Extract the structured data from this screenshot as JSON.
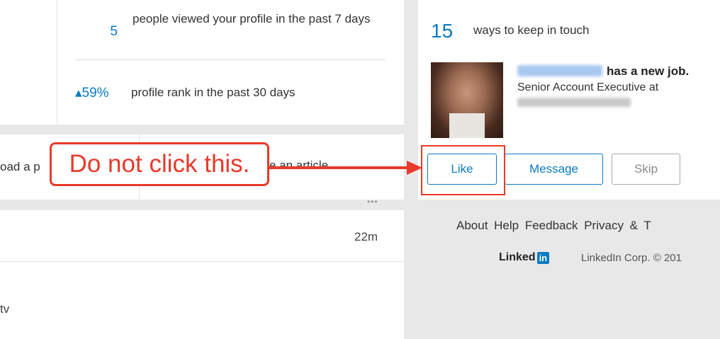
{
  "stats": {
    "views_count": "5",
    "views_text": "people viewed your profile in the past 7 days",
    "rank_change": "▴59%",
    "rank_text": "profile rank in the past 30 days"
  },
  "share": {
    "left_text": "oad a p",
    "right_text": "e an article"
  },
  "feed": {
    "time": "22m",
    "snippet": "tv",
    "more": "•••"
  },
  "keep_in_touch": {
    "count": "15",
    "label": "ways to keep in touch",
    "headline_suffix": "has a new job.",
    "job_title": "Senior Account Executive at"
  },
  "actions": {
    "like": "Like",
    "message": "Message",
    "skip": "Skip"
  },
  "footer": {
    "links": "About Help Feedback Privacy & T",
    "logo_word": "Linked",
    "logo_in": "in",
    "copyright": "LinkedIn Corp. © 201"
  },
  "annotation": {
    "text": "Do not click this.",
    "color": "#e8392a"
  },
  "colors": {
    "accent": "#0b7bc1",
    "background": "#e8e8e8"
  }
}
